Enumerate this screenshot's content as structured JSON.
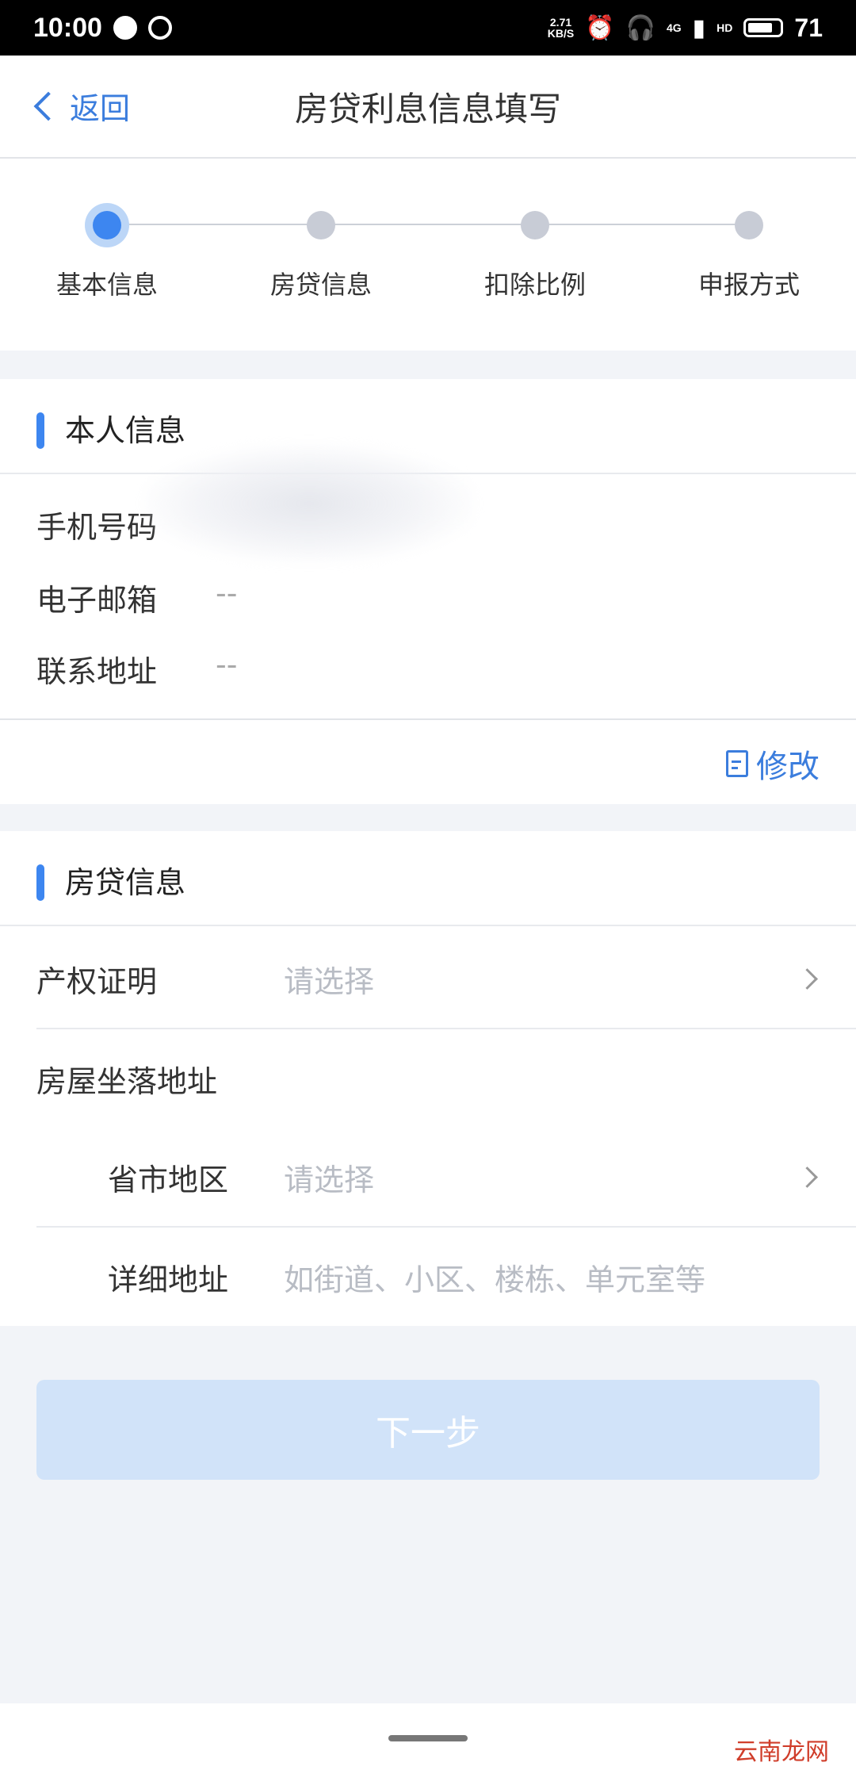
{
  "status_bar": {
    "time": "10:00",
    "speed": "2.71\nKB/S",
    "network": "4G",
    "hd": "HD",
    "battery": "71"
  },
  "navbar": {
    "back_label": "返回",
    "title": "房贷利息信息填写"
  },
  "stepper": {
    "steps": [
      {
        "label": "基本信息",
        "active": true
      },
      {
        "label": "房贷信息",
        "active": false
      },
      {
        "label": "扣除比例",
        "active": false
      },
      {
        "label": "申报方式",
        "active": false
      }
    ]
  },
  "personal": {
    "title": "本人信息",
    "rows": [
      {
        "label": "手机号码",
        "value": ""
      },
      {
        "label": "电子邮箱",
        "value": "--"
      },
      {
        "label": "联系地址",
        "value": "--"
      }
    ],
    "edit_label": "修改"
  },
  "loan": {
    "title": "房贷信息",
    "property_cert_label": "产权证明",
    "property_cert_placeholder": "请选择",
    "address_label": "房屋坐落地址",
    "region_label": "省市地区",
    "region_placeholder": "请选择",
    "detail_label": "详细地址",
    "detail_placeholder": "如街道、小区、楼栋、单元室等"
  },
  "next_button": "下一步",
  "watermark": "云南龙网",
  "colors": {
    "accent": "#3d86f0",
    "link": "#3b7ddd",
    "button_disabled": "#d1e3f9"
  }
}
